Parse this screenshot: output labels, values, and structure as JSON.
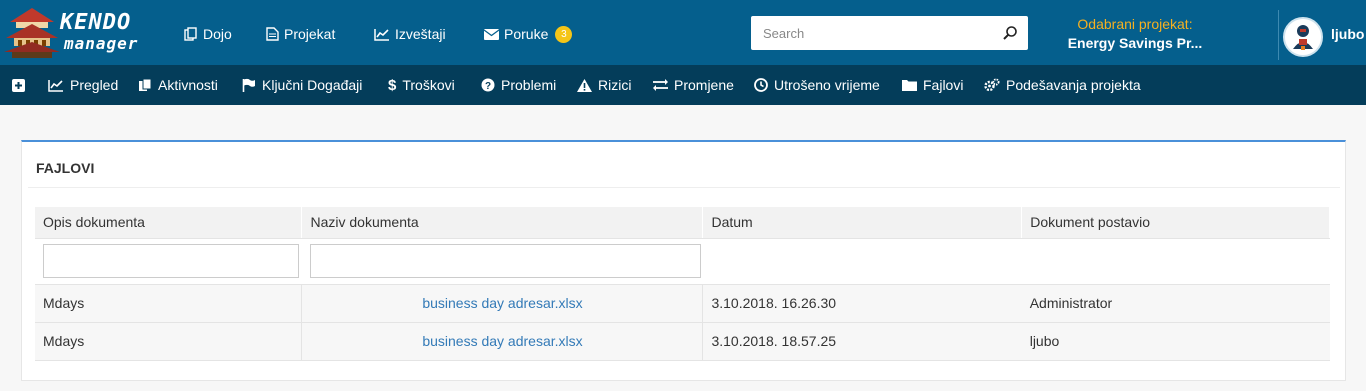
{
  "app": {
    "logo_line1": "KENDO",
    "logo_line2": "manager"
  },
  "topnav": {
    "items": [
      {
        "label": "Dojo",
        "icon": "copy-icon"
      },
      {
        "label": "Projekat",
        "icon": "file-icon"
      },
      {
        "label": "Izveštaji",
        "icon": "line-chart-icon"
      },
      {
        "label": "Poruke",
        "icon": "envelope-icon",
        "badge": "3"
      }
    ]
  },
  "search": {
    "placeholder": "Search"
  },
  "project": {
    "label": "Odabrani projekat:",
    "value": "Energy Savings Pr..."
  },
  "user": {
    "name": "ljubo"
  },
  "subnav": {
    "items": [
      {
        "label": "",
        "icon": "plus-square-icon"
      },
      {
        "label": "Pregled",
        "icon": "line-chart-icon"
      },
      {
        "label": "Aktivnosti",
        "icon": "copy-icon"
      },
      {
        "label": "Ključni Događaji",
        "icon": "flag-icon"
      },
      {
        "label": "Troškovi",
        "icon": "dollar-icon"
      },
      {
        "label": "Problemi",
        "icon": "question-circle-icon"
      },
      {
        "label": "Rizici",
        "icon": "warning-icon"
      },
      {
        "label": "Promjene",
        "icon": "exchange-icon"
      },
      {
        "label": "Utrošeno vrijeme",
        "icon": "clock-icon"
      },
      {
        "label": "Fajlovi",
        "icon": "folder-icon"
      },
      {
        "label": "Podešavanja projekta",
        "icon": "gears-icon"
      }
    ]
  },
  "panel": {
    "title": "FAJLOVI"
  },
  "table": {
    "columns": [
      "Opis dokumenta",
      "Naziv dokumenta",
      "Datum",
      "Dokument postavio"
    ],
    "filters": {
      "description": "",
      "name": ""
    },
    "rows": [
      {
        "description": "Mdays",
        "file": "business day adresar.xlsx",
        "date": "3.10.2018. 16.26.30",
        "uploader": "Administrator"
      },
      {
        "description": "Mdays",
        "file": "business day adresar.xlsx",
        "date": "3.10.2018. 18.57.25",
        "uploader": "ljubo"
      }
    ]
  },
  "colors": {
    "topbar": "#055f8d",
    "subbar": "#043d5a",
    "accent": "#f5b021",
    "link": "#337ab7",
    "badge": "#f5c518"
  }
}
